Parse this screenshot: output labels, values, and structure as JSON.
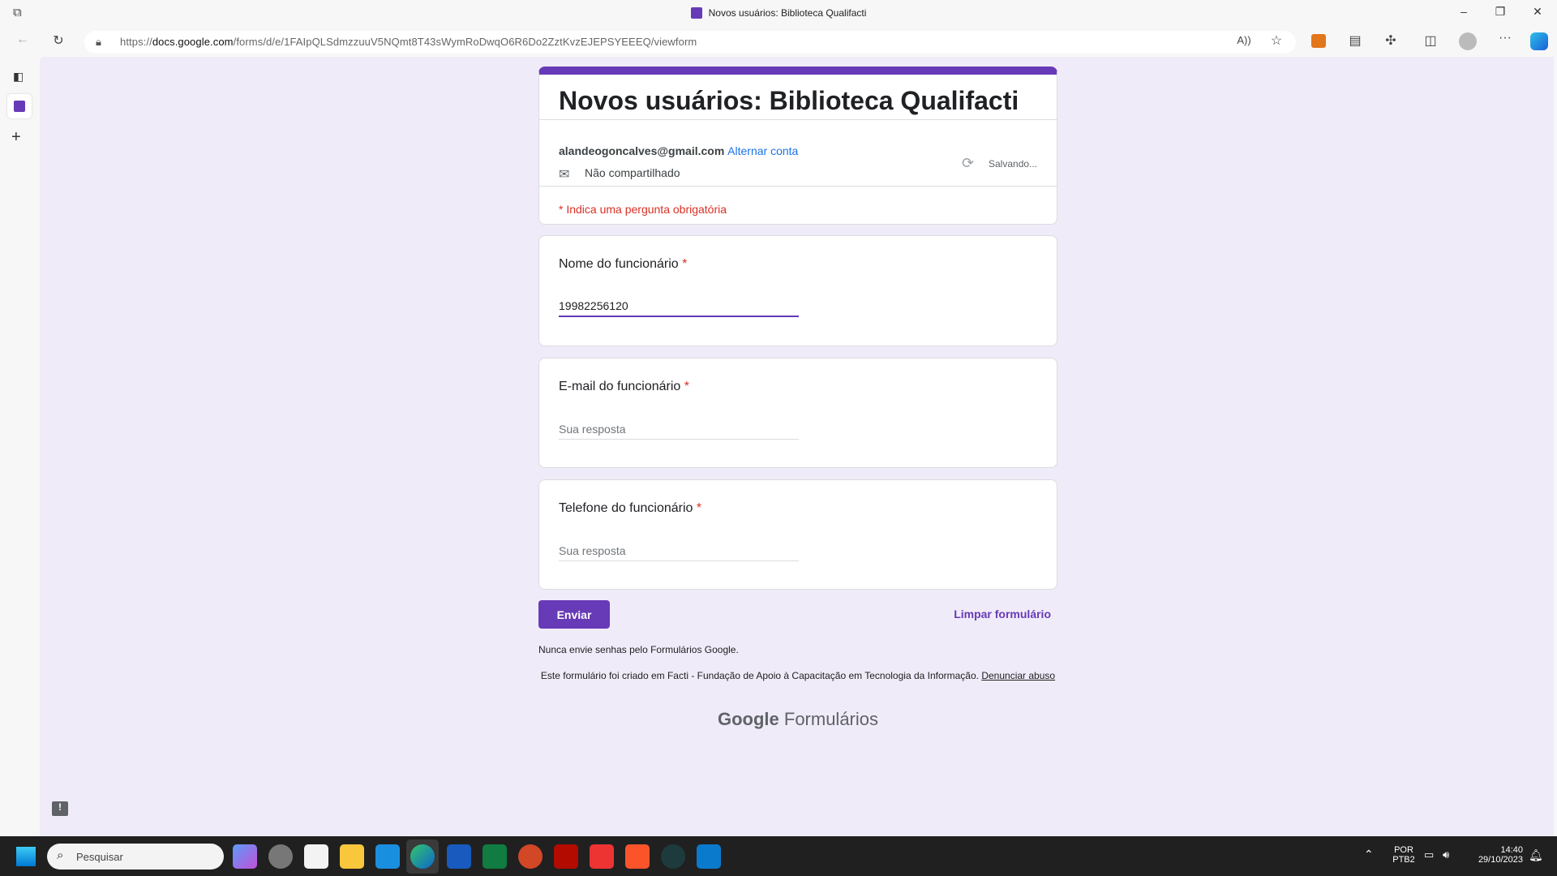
{
  "browser": {
    "tab_title": "Novos usuários: Biblioteca Qualifacti",
    "url_prefix": "https://",
    "url_host": "docs.google.com",
    "url_path": "/forms/d/e/1FAIpQLSdmzzuuV5NQmt8T43sWymRoDwqO6R6Do2ZztKvzEJEPSYEEEQ/viewform"
  },
  "form": {
    "accent": "#673ab7",
    "title": "Novos usuários: Biblioteca Qualifacti",
    "account_email": "alandeogoncalves@gmail.com",
    "switch_account": "Alternar conta",
    "not_shared": "Não compartilhado",
    "saving": "Salvando...",
    "required_note": "* Indica uma pergunta obrigatória",
    "questions": [
      {
        "label": "Nome do funcionário",
        "required": "*",
        "value": "19982256120",
        "placeholder": "Sua resposta"
      },
      {
        "label": "E-mail do funcionário",
        "required": "*",
        "value": "",
        "placeholder": "Sua resposta"
      },
      {
        "label": "Telefone do funcionário",
        "required": "*",
        "value": "",
        "placeholder": "Sua resposta"
      }
    ],
    "submit": "Enviar",
    "clear": "Limpar formulário",
    "never_passwords": "Nunca envie senhas pelo Formulários Google.",
    "created_in": "Este formulário foi criado em Facti - Fundação de Apoio à Capacitação em Tecnologia da Informação.",
    "report_abuse": "Denunciar abuso",
    "brand_google": "Google",
    "brand_forms": "Formulários"
  },
  "taskbar": {
    "search_placeholder": "Pesquisar",
    "lang1": "POR",
    "lang2": "PTB2",
    "time": "14:40",
    "date": "29/10/2023"
  }
}
